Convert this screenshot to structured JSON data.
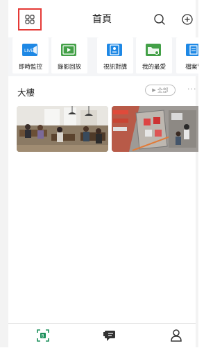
{
  "header": {
    "title": "首頁",
    "menu_icon": "grid-icon",
    "search_icon": "search-icon",
    "add_icon": "add-circle-icon",
    "highlight_color": "#e53935"
  },
  "quick_actions": [
    {
      "label": "即時監控",
      "icon": "live-camera-icon",
      "color": "#1e88e5"
    },
    {
      "label": "錄影回放",
      "icon": "playback-icon",
      "color": "#43a047"
    },
    {
      "label": "視訊對講",
      "icon": "intercom-icon",
      "color": "#1e88e5"
    },
    {
      "label": "我的最愛",
      "icon": "favorite-folder-icon",
      "color": "#43a047"
    },
    {
      "label": "檔案管",
      "icon": "file-icon",
      "color": "#1e88e5"
    }
  ],
  "live_badge": "LIVE",
  "section": {
    "title": "大樓",
    "all_label": "全部",
    "more_icon": "more-icon"
  },
  "cameras": [
    {
      "name": "camera-thumbnail-cafe",
      "scene": "cafe"
    },
    {
      "name": "camera-thumbnail-warehouse",
      "scene": "warehouse"
    }
  ],
  "tabs": [
    {
      "icon": "home-tab-icon",
      "active": true
    },
    {
      "icon": "message-tab-icon",
      "active": false
    },
    {
      "icon": "profile-tab-icon",
      "active": false
    }
  ],
  "colors": {
    "accent_green": "#1a8f5a",
    "accent_blue": "#1e88e5"
  }
}
